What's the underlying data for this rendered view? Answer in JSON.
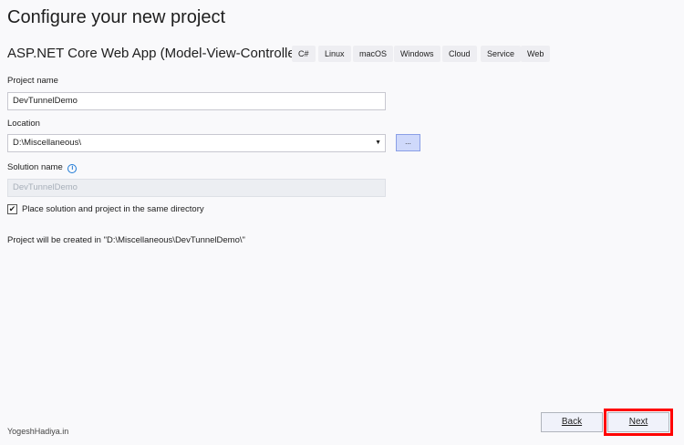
{
  "title": "Configure your new project",
  "template_name": "ASP.NET Core Web App (Model-View-Controller)",
  "tags": [
    "C#",
    "Linux",
    "macOS",
    "Windows",
    "Cloud",
    "Service",
    "Web"
  ],
  "project_name": {
    "label": "Project name",
    "value": "DevTunnelDemo"
  },
  "location": {
    "label": "Location",
    "value": "D:\\Miscellaneous\\",
    "browse_label": "..."
  },
  "solution_name": {
    "label": "Solution name",
    "value": "DevTunnelDemo"
  },
  "same_dir": {
    "label": "Place solution and project in the same directory",
    "checked": true
  },
  "path_info": "Project will be created in \"D:\\Miscellaneous\\DevTunnelDemo\\\"",
  "watermark": "YogeshHadiya.in",
  "buttons": {
    "back": "Back",
    "next": "Next"
  },
  "colors": {
    "highlight": "#ff0000",
    "info": "#1e7ad6"
  }
}
